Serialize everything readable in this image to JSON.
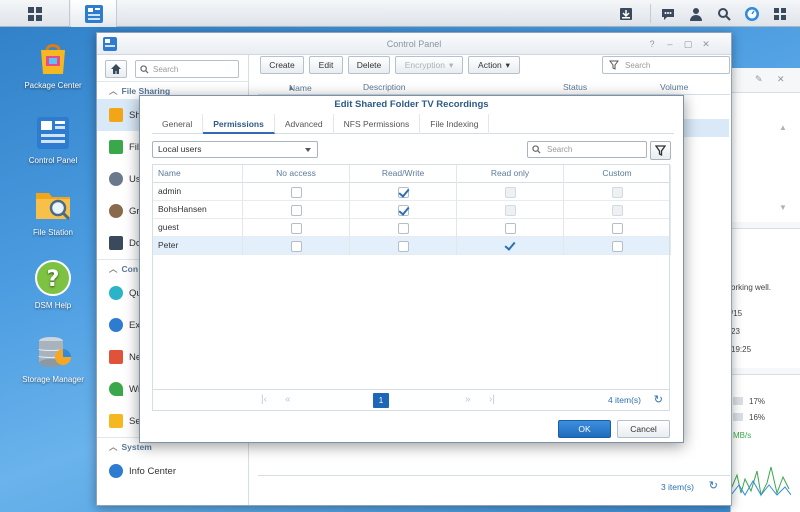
{
  "desktop": {
    "icons": [
      {
        "label": "Package Center"
      },
      {
        "label": "Control Panel"
      },
      {
        "label": "File Station"
      },
      {
        "label": "DSM Help"
      },
      {
        "label": "Storage Manager"
      }
    ]
  },
  "background_window": {
    "rows": [
      "e 1",
      "e 1",
      "vice"
    ],
    "text_lines": [
      "orking well.",
      "/15",
      "23",
      "19:25"
    ],
    "stats": [
      "17%",
      "16%",
      "MB/s"
    ]
  },
  "control_panel": {
    "title": "Control Panel",
    "search_placeholder": "Search",
    "sidebar": {
      "group_file_sharing": "File Sharing",
      "group_connectivity": "Con",
      "group_system": "System",
      "items": [
        {
          "label": "Sha"
        },
        {
          "label": "Fil"
        },
        {
          "label": "Us"
        },
        {
          "label": "Gr"
        },
        {
          "label": "Do"
        },
        {
          "label": "Qu"
        },
        {
          "label": "Ex"
        },
        {
          "label": "Ne"
        },
        {
          "label": "Wi"
        },
        {
          "label": "Se"
        },
        {
          "label": "Info Center"
        }
      ]
    },
    "toolbar": {
      "create": "Create",
      "edit": "Edit",
      "delete": "Delete",
      "encryption": "Encryption",
      "action": "Action",
      "search_placeholder": "Search"
    },
    "columns": {
      "name": "Name",
      "description": "Description",
      "status": "Status",
      "volume": "Volume"
    },
    "footer_count": "3 item(s)"
  },
  "dialog": {
    "title": "Edit Shared Folder TV Recordings",
    "tabs": [
      "General",
      "Permissions",
      "Advanced",
      "NFS Permissions",
      "File Indexing"
    ],
    "active_tab": "Permissions",
    "user_scope": "Local users",
    "search_placeholder": "Search",
    "columns": {
      "name": "Name",
      "no_access": "No access",
      "read_write": "Read/Write",
      "read_only": "Read only",
      "custom": "Custom"
    },
    "rows": [
      {
        "name": "admin",
        "no_access": false,
        "read_write": true,
        "read_only": false,
        "custom": false
      },
      {
        "name": "BohsHansen",
        "no_access": false,
        "read_write": true,
        "read_only": false,
        "custom": false
      },
      {
        "name": "guest",
        "no_access": false,
        "read_write": false,
        "read_only": false,
        "custom": false
      },
      {
        "name": "Peter",
        "no_access": false,
        "read_write": false,
        "read_only": true,
        "custom": false
      }
    ],
    "pager": {
      "current_page": "1",
      "count": "4 item(s)"
    },
    "ok": "OK",
    "cancel": "Cancel"
  }
}
